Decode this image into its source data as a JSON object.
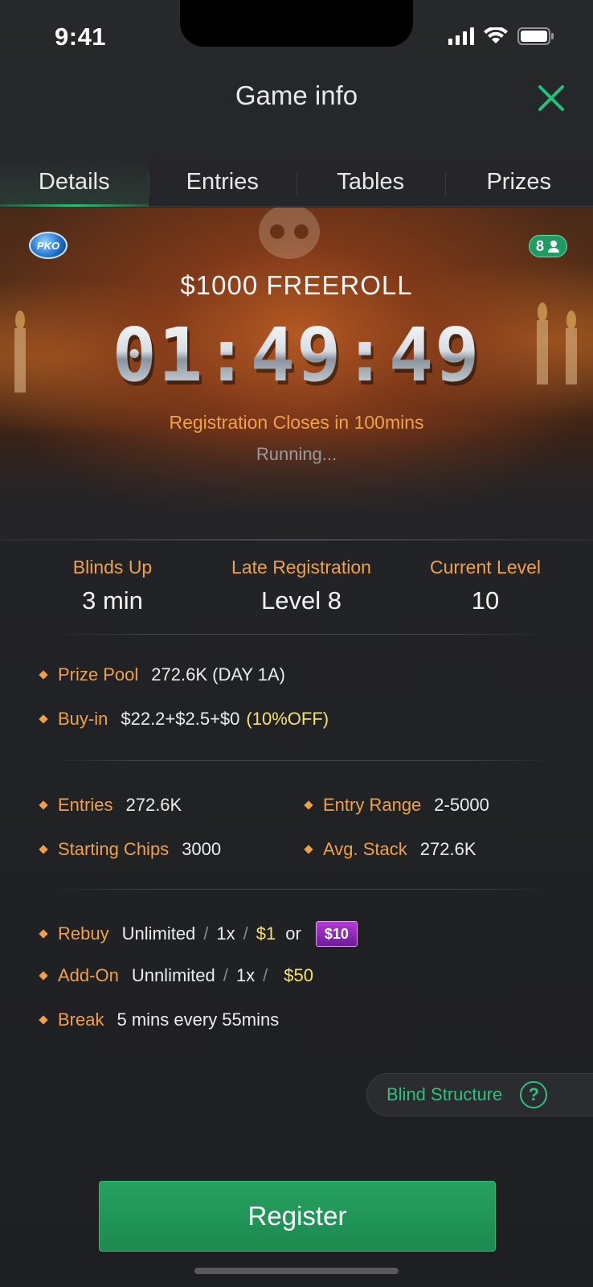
{
  "status_bar": {
    "time": "9:41"
  },
  "header": {
    "title": "Game info"
  },
  "tabs": [
    {
      "label": "Details",
      "active": true
    },
    {
      "label": "Entries",
      "active": false
    },
    {
      "label": "Tables",
      "active": false
    },
    {
      "label": "Prizes",
      "active": false
    }
  ],
  "banner": {
    "badge": "PKO",
    "players": "8",
    "title": "$1000 FREEROLL",
    "countdown": "01:49:49",
    "registration_closes": "Registration Closes in 100mins",
    "status": "Running..."
  },
  "stats": [
    {
      "label": "Blinds Up",
      "value": "3 min"
    },
    {
      "label": "Late Registration",
      "value": "Level 8"
    },
    {
      "label": "Current Level",
      "value": "10"
    }
  ],
  "info": {
    "prize_pool": {
      "label": "Prize Pool",
      "value": "272.6K (DAY 1A)"
    },
    "buy_in": {
      "label": "Buy-in",
      "value": "$22.2+$2.5+$0",
      "discount": "(10%OFF)"
    },
    "entries": {
      "label": "Entries",
      "value": "272.6K"
    },
    "entry_range": {
      "label": "Entry Range",
      "value": "2-5000"
    },
    "starting_chips": {
      "label": "Starting Chips",
      "value": "3000"
    },
    "avg_stack": {
      "label": "Avg. Stack",
      "value": "272.6K"
    },
    "rebuy": {
      "label": "Rebuy",
      "limit": "Unlimited",
      "count": "1x",
      "price": "$1",
      "or": "or",
      "ticket": "$10"
    },
    "addon": {
      "label": "Add-On",
      "limit": "Unnlimited",
      "count": "1x",
      "price": "$50"
    },
    "break": {
      "label": "Break",
      "value": "5 mins every 55mins"
    }
  },
  "blind_structure": {
    "label": "Blind Structure",
    "icon": "?"
  },
  "register": {
    "label": "Register"
  },
  "colors": {
    "accent_green": "#23c47a",
    "label_orange": "#f0a04a",
    "price_gold": "#f5e06a",
    "register_green": "#1d8a50"
  }
}
